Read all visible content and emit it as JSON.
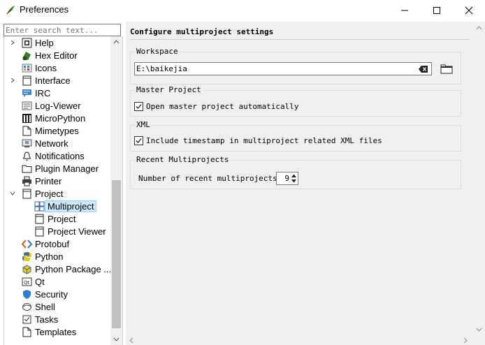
{
  "window": {
    "title": "Preferences",
    "controls": {
      "minimize": "minimize",
      "maximize": "maximize",
      "close": "close"
    }
  },
  "sidebar": {
    "search_placeholder": "Enter search text...",
    "items": [
      {
        "label": "Help",
        "icon": "help-icon",
        "expandable": true
      },
      {
        "label": "Hex Editor",
        "icon": "hex-editor-icon"
      },
      {
        "label": "Icons",
        "icon": "icons-icon"
      },
      {
        "label": "Interface",
        "icon": "interface-icon",
        "expandable": true
      },
      {
        "label": "IRC",
        "icon": "irc-icon"
      },
      {
        "label": "Log-Viewer",
        "icon": "log-viewer-icon"
      },
      {
        "label": "MicroPython",
        "icon": "micropython-icon"
      },
      {
        "label": "Mimetypes",
        "icon": "mimetypes-icon"
      },
      {
        "label": "Network",
        "icon": "network-icon"
      },
      {
        "label": "Notifications",
        "icon": "notifications-icon"
      },
      {
        "label": "Plugin Manager",
        "icon": "plugin-manager-icon"
      },
      {
        "label": "Printer",
        "icon": "printer-icon"
      },
      {
        "label": "Project",
        "icon": "project-icon",
        "expanded": true
      },
      {
        "label": "Multiproject",
        "icon": "multiproject-icon",
        "child": true,
        "selected": true
      },
      {
        "label": "Project",
        "icon": "project-sub-icon",
        "child": true
      },
      {
        "label": "Project Viewer",
        "icon": "project-viewer-icon",
        "child": true
      },
      {
        "label": "Protobuf",
        "icon": "protobuf-icon"
      },
      {
        "label": "Python",
        "icon": "python-icon"
      },
      {
        "label": "Python Package ...",
        "icon": "python-package-icon"
      },
      {
        "label": "Qt",
        "icon": "qt-icon"
      },
      {
        "label": "Security",
        "icon": "security-icon"
      },
      {
        "label": "Shell",
        "icon": "shell-icon"
      },
      {
        "label": "Tasks",
        "icon": "tasks-icon"
      },
      {
        "label": "Templates",
        "icon": "templates-icon"
      }
    ]
  },
  "main": {
    "heading": "Configure multiproject settings",
    "workspace": {
      "title": "Workspace",
      "value": "E:\\baikejia"
    },
    "master": {
      "title": "Master Project",
      "checkbox_label": "Open master project automatically",
      "checked": true
    },
    "xml": {
      "title": "XML",
      "checkbox_label": "Include timestamp in multiproject related XML files",
      "checked": true
    },
    "recent": {
      "title": "Recent Multiprojects",
      "label": "Number of recent multiprojects:",
      "value": "9"
    }
  },
  "colors": {
    "selection_bg": "#cce8ff",
    "selection_border": "#99d1ff",
    "pane_bg": "#f0f0f0"
  }
}
